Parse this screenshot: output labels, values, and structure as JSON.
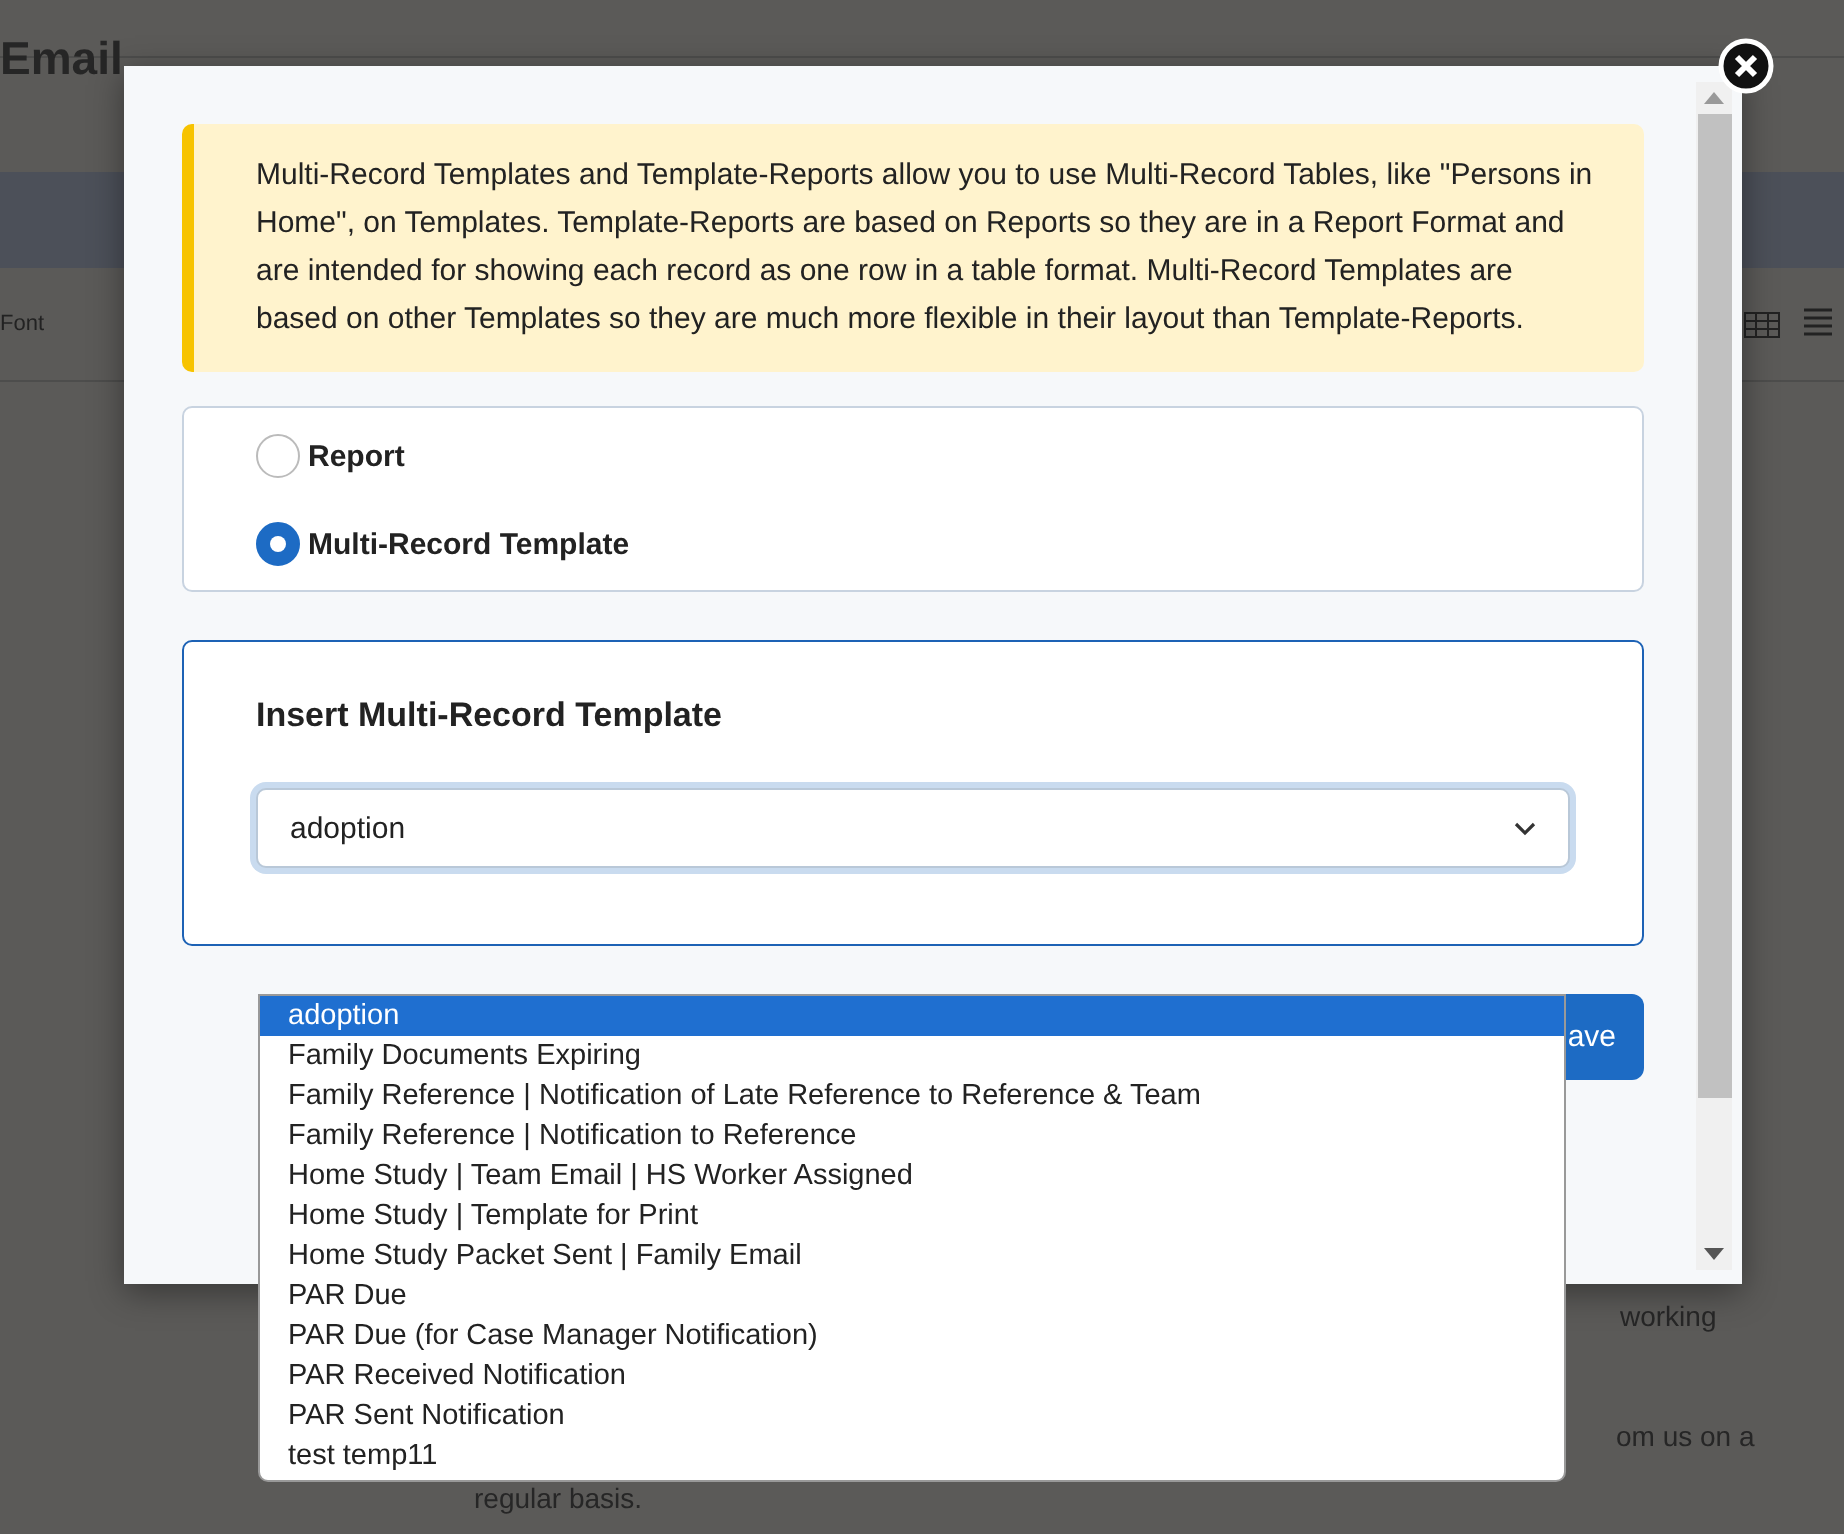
{
  "background_page": {
    "heading": "Email",
    "toolbar_label": "Font",
    "text_fragments": [
      {
        "text": "working"
      },
      {
        "text": "om us on a"
      },
      {
        "text": "regular basis."
      }
    ]
  },
  "dialog": {
    "notice": "Multi-Record Templates and Template-Reports allow you to use Multi-Record Tables, like \"Persons in Home\", on Templates. Template-Reports are based on Reports so they are in a Report Format and are intended for showing each record as one row in a table format. Multi-Record Templates are based on other Templates so they are much more flexible in their layout than Template-Reports.",
    "options": [
      {
        "label": "Report",
        "selected": false
      },
      {
        "label": "Multi-Record Template",
        "selected": true
      }
    ],
    "insert_title": "Insert Multi-Record Template",
    "select": {
      "value": "adoption",
      "expanded": true
    },
    "dropdown_options": [
      {
        "label": "adoption",
        "selected": true
      },
      {
        "label": "Family Documents Expiring",
        "selected": false
      },
      {
        "label": "Family Reference | Notification of Late Reference to Reference & Team",
        "selected": false
      },
      {
        "label": "Family Reference | Notification to Reference",
        "selected": false
      },
      {
        "label": "Home Study | Team Email | HS Worker Assigned",
        "selected": false
      },
      {
        "label": "Home Study | Template for Print",
        "selected": false
      },
      {
        "label": "Home Study Packet Sent | Family Email",
        "selected": false
      },
      {
        "label": "PAR Due",
        "selected": false
      },
      {
        "label": "PAR Due (for Case Manager Notification)",
        "selected": false
      },
      {
        "label": "PAR Received Notification",
        "selected": false
      },
      {
        "label": "PAR Sent Notification",
        "selected": false
      },
      {
        "label": "test temp11",
        "selected": false
      }
    ],
    "save_button": "ave"
  }
}
